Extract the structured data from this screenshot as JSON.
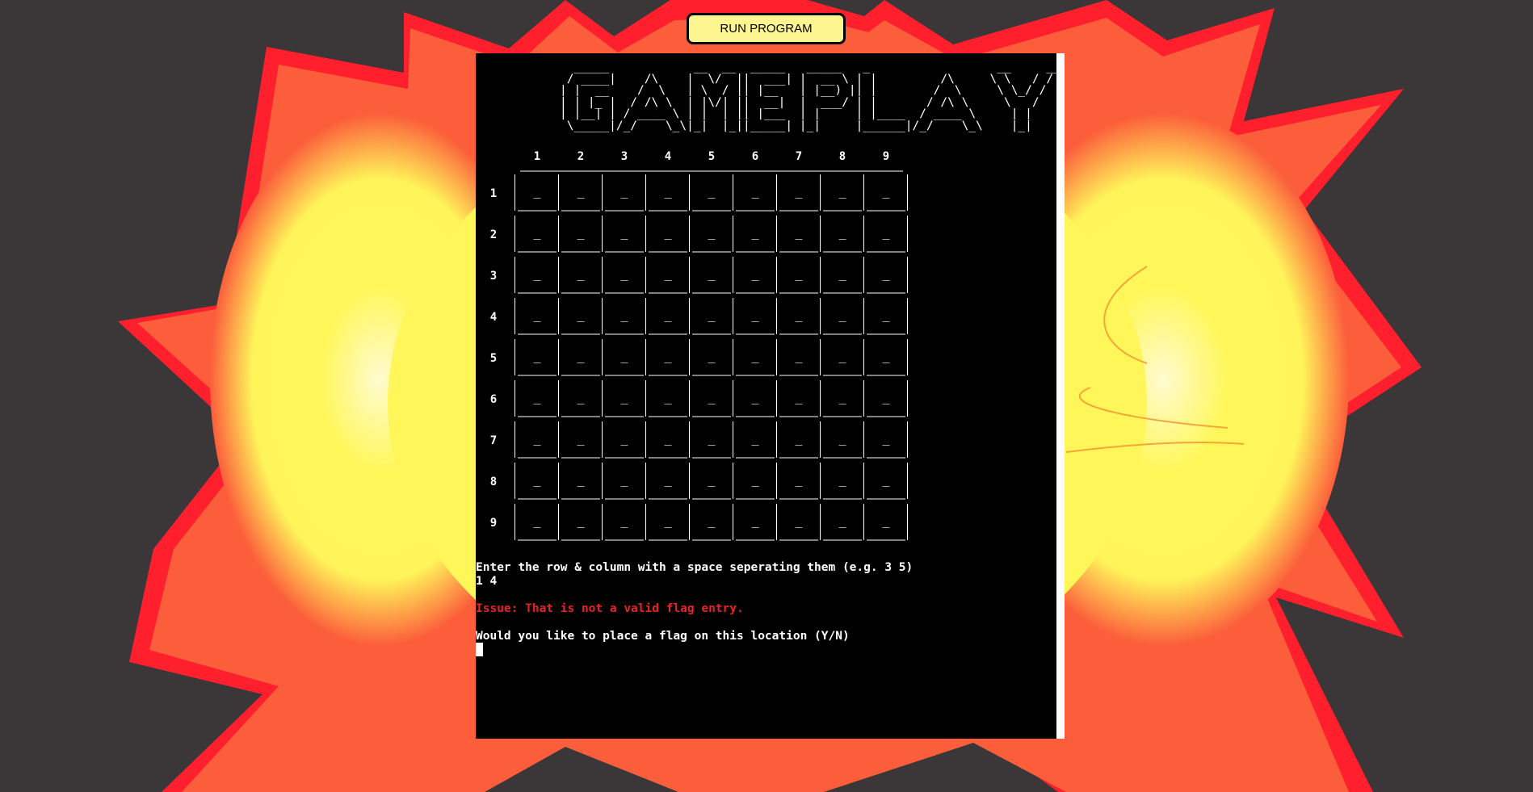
{
  "toolbar": {
    "run_label": "RUN PROGRAM"
  },
  "banner": {
    "title": "GAMEPLAY",
    "ascii": "  _____            __  __  _____   _____   _                  __     __\n / ____|    /\\    |  \\/  ||  ___| |  __ \\ | |         /\\     \\ \\   / /\n| |  __    /  \\   | \\  / || |__   | |__) || |        /  \\     \\ \\_/ /\n| | |_ |  / /\\ \\  | |\\/| ||  __|  |  ___/ | |       / /\\ \\     \\   /\n| |__| | / ____ \\ | |  | || |___  | |     | |____  / ____ \\     | |\n \\_____|/_/    \\_\\|_|  |_||_____| |_|     |______|/_/    \\_\\    |_|"
  },
  "board": {
    "column_headers": [
      "1",
      "2",
      "3",
      "4",
      "5",
      "6",
      "7",
      "8",
      "9"
    ],
    "row_headers": [
      "1",
      "2",
      "3",
      "4",
      "5",
      "6",
      "7",
      "8",
      "9"
    ],
    "cells": [
      [
        "_",
        "_",
        "_",
        "_",
        "_",
        "_",
        "_",
        "_",
        "_"
      ],
      [
        "_",
        "_",
        "_",
        "_",
        "_",
        "_",
        "_",
        "_",
        "_"
      ],
      [
        "_",
        "_",
        "_",
        "_",
        "_",
        "_",
        "_",
        "_",
        "_"
      ],
      [
        "_",
        "_",
        "_",
        "_",
        "_",
        "_",
        "_",
        "_",
        "_"
      ],
      [
        "_",
        "_",
        "_",
        "_",
        "_",
        "_",
        "_",
        "_",
        "_"
      ],
      [
        "_",
        "_",
        "_",
        "_",
        "_",
        "_",
        "_",
        "_",
        "_"
      ],
      [
        "_",
        "_",
        "_",
        "_",
        "_",
        "_",
        "_",
        "_",
        "_"
      ],
      [
        "_",
        "_",
        "_",
        "_",
        "_",
        "_",
        "_",
        "_",
        "_"
      ],
      [
        "_",
        "_",
        "_",
        "_",
        "_",
        "_",
        "_",
        "_",
        "_"
      ]
    ]
  },
  "terminal": {
    "prompt_coords": "Enter the row & column with a space seperating them (e.g. 3 5)",
    "user_input": "1 4",
    "error": "Issue: That is not a valid flag entry.",
    "prompt_flag": "Would you like to place a flag on this location (Y/N)"
  },
  "colors": {
    "page_bg": "#3b3637",
    "flame_outer": "#ff1f2d",
    "flame_mid": "#fc5e3b",
    "flame_core": "#fff759",
    "button_bg": "#fdf590",
    "terminal_bg": "#000000",
    "error_text": "#e82424"
  }
}
